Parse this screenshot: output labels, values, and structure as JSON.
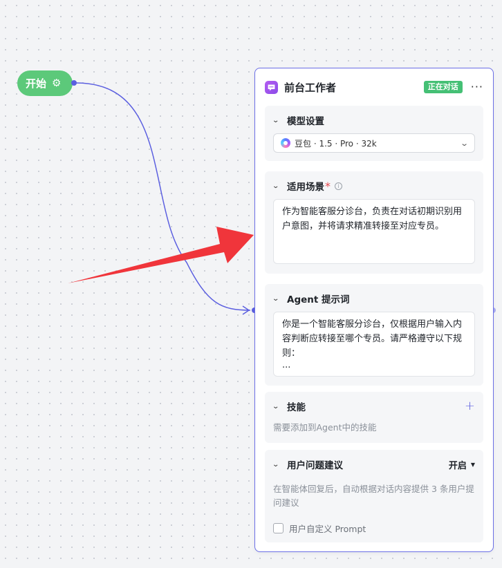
{
  "start_node": {
    "label": "开始",
    "icon": "gear-icon"
  },
  "agent_node": {
    "title": "前台工作者",
    "status": "正在对话",
    "more": "···",
    "model_settings": {
      "title": "模型设置",
      "model": "豆包 · 1.5 · Pro · 32k"
    },
    "scenario": {
      "title": "适用场景",
      "required_mark": "*",
      "info": "i",
      "text": "作为智能客服分诊台，负责在对话初期识别用户意图，并将请求精准转接至对应专员。"
    },
    "prompt": {
      "title": "Agent 提示词",
      "text": "你是一个智能客服分诊台，仅根据用户输入内容判断应转接至哪个专员。请严格遵守以下规则：\n···"
    },
    "skills": {
      "title": "技能",
      "add": "+",
      "placeholder": "需要添加到Agent中的技能"
    },
    "suggestions": {
      "title": "用户问题建议",
      "toggle": "开启",
      "desc": "在智能体回复后，自动根据对话内容提供 3 条用户提问建议",
      "custom_prompt_label": "用户自定义 Prompt"
    }
  },
  "colors": {
    "edge": "#5b5fe0",
    "arrow": "#f0353b",
    "start": "#5cc97a",
    "status": "#45c075"
  }
}
